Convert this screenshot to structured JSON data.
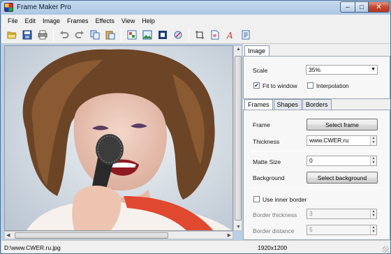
{
  "window": {
    "title": "Frame Maker Pro"
  },
  "menu": [
    "File",
    "Edit",
    "Image",
    "Frames",
    "Effects",
    "View",
    "Help"
  ],
  "toolbar_icons": [
    "open-icon",
    "save-icon",
    "print-icon",
    "undo-icon",
    "redo-icon",
    "copy-icon",
    "paste-icon",
    "image-icon",
    "picture-icon",
    "frame-icon",
    "shape-icon",
    "crop-icon",
    "document-icon",
    "text-icon",
    "page-icon"
  ],
  "image_panel": {
    "tab": "Image",
    "scale_label": "Scale",
    "scale_value": "35%",
    "fit_label": "Fit to window",
    "fit_checked": true,
    "interp_label": "Interpolation",
    "interp_checked": false
  },
  "frames_panel": {
    "tabs": [
      "Frames",
      "Shapes",
      "Borders"
    ],
    "active_tab": "Frames",
    "frame_label": "Frame",
    "select_frame": "Select frame",
    "thickness_label": "Thickness",
    "thickness_value": "www.CWER.ru",
    "matte_label": "Matte Size",
    "matte_value": "0",
    "background_label": "Background",
    "select_background": "Select background",
    "inner_border_label": "Use inner border",
    "inner_border_checked": false,
    "border_thickness_label": "Border thickness",
    "border_thickness_value": "3",
    "border_distance_label": "Border distance",
    "border_distance_value": "5"
  },
  "status": {
    "path": "D:\\www.CWER.ru.jpg",
    "dimensions": "1920x1200"
  }
}
